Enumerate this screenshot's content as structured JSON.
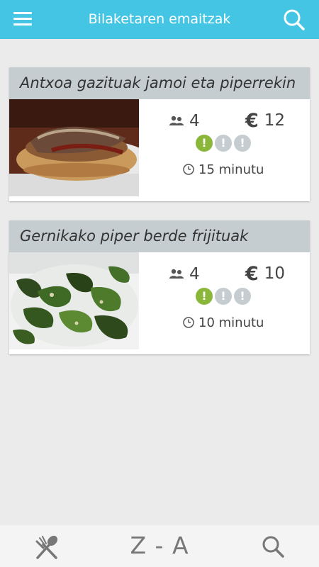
{
  "header": {
    "title": "Bilaketaren emaitzak",
    "menu_icon": "hamburger-menu-icon",
    "search_icon": "search-icon"
  },
  "results": [
    {
      "title": "Antxoa gazituak jamoi eta piperrekin",
      "people": "4",
      "currency": "€",
      "price": "12",
      "difficulty": {
        "level": 1,
        "of": 3,
        "mark": "!"
      },
      "time": "15 minutu"
    },
    {
      "title": "Gernikako piper berde frijituak",
      "people": "4",
      "currency": "€",
      "price": "10",
      "difficulty": {
        "level": 1,
        "of": 3,
        "mark": "!"
      },
      "time": "10 minutu"
    }
  ],
  "bottom_bar": {
    "recipes_icon": "fork-spoon-icon",
    "sort_label": "Z - A",
    "search_icon": "search-icon"
  },
  "colors": {
    "topbar": "#45c5e4",
    "title_strip": "#c5cdd0",
    "difficulty_active": "#8ab73a",
    "difficulty_inactive": "#c5cdd0"
  }
}
